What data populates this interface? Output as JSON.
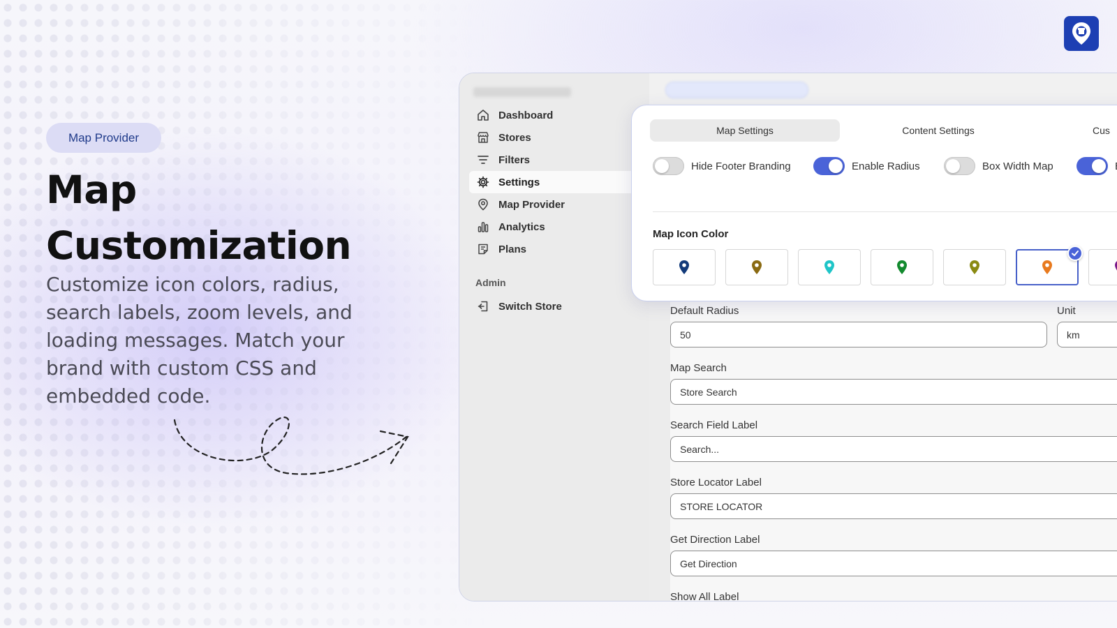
{
  "hero": {
    "badge": "Map Provider",
    "title": "Map Customization",
    "description": "Customize icon colors, radius, search labels, zoom levels, and loading messages. Match your brand with custom CSS and embedded code."
  },
  "sidebar": {
    "items": [
      {
        "label": "Dashboard",
        "icon": "home-icon"
      },
      {
        "label": "Stores",
        "icon": "store-icon"
      },
      {
        "label": "Filters",
        "icon": "filter-icon"
      },
      {
        "label": "Settings",
        "icon": "gear-icon",
        "active": true
      },
      {
        "label": "Map Provider",
        "icon": "map-pin-icon"
      },
      {
        "label": "Analytics",
        "icon": "bar-chart-icon"
      },
      {
        "label": "Plans",
        "icon": "plans-icon"
      }
    ],
    "section_label": "Admin",
    "switch_store": "Switch Store"
  },
  "card": {
    "tabs": [
      "Map Settings",
      "Content Settings",
      "Cus"
    ],
    "toggles": [
      {
        "label": "Hide Footer Branding",
        "on": false
      },
      {
        "label": "Enable Radius",
        "on": true
      },
      {
        "label": "Box Width Map",
        "on": false
      },
      {
        "label": "E",
        "on": true
      }
    ],
    "icon_color_label": "Map Icon Color",
    "swatches": [
      "#123a7a",
      "#8a6a12",
      "#1fc5c8",
      "#128a2e",
      "#8a8a12",
      "#e87a1e",
      "#7a1a8a"
    ],
    "selected_swatch": 5
  },
  "form": {
    "default_radius_label": "Default Radius",
    "default_radius_value": "50",
    "unit_label": "Unit",
    "unit_value": "km",
    "map_search_label": "Map Search",
    "map_search_value": "Store Search",
    "search_field_label": "Search Field Label",
    "search_field_value": "Search...",
    "store_locator_label": "Store Locator Label",
    "store_locator_value": "STORE LOCATOR",
    "get_direction_label": "Get Direction Label",
    "get_direction_value": "Get Direction",
    "show_all_label": "Show All Label"
  },
  "colors": {
    "accent": "#4a63d8",
    "logo_bg": "#1d3fb3"
  }
}
